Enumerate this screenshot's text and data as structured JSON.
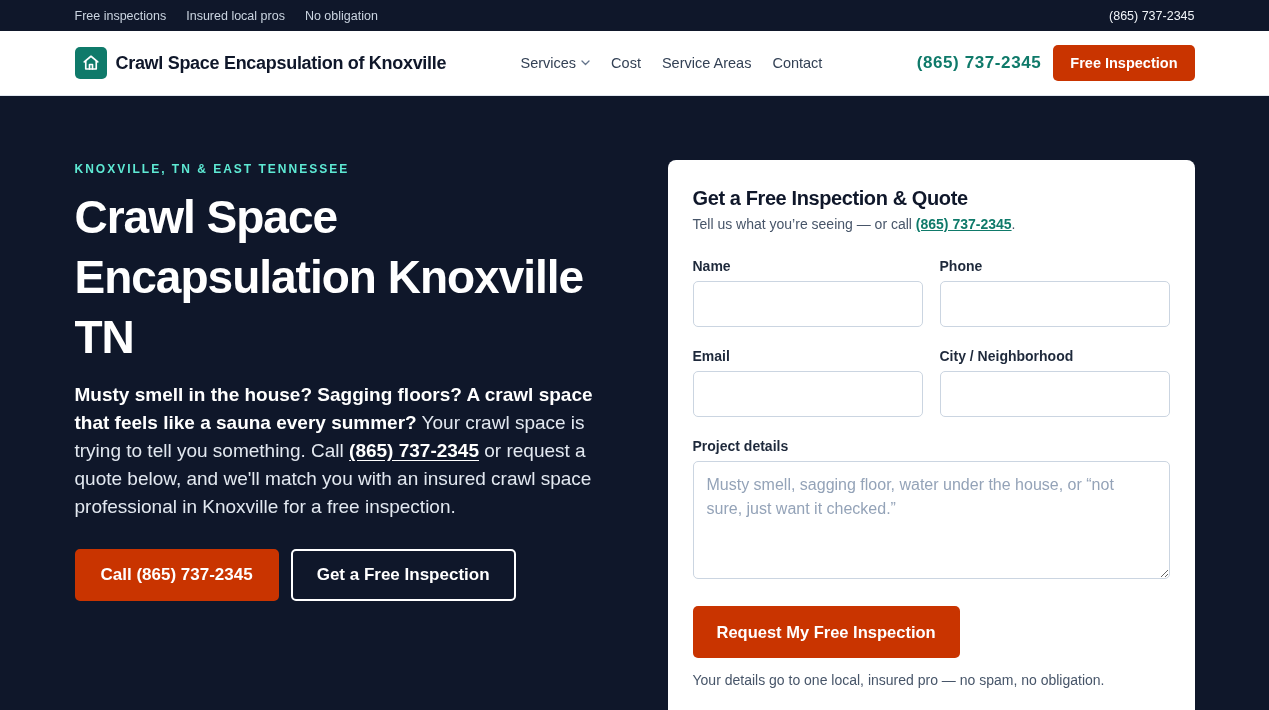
{
  "top_bar": {
    "badges": [
      "Free inspections",
      "Insured local pros",
      "No obligation"
    ],
    "phone": "(865) 737-2345"
  },
  "header": {
    "brand": "Crawl Space Encapsulation of Knoxville",
    "nav": [
      {
        "label": "Services",
        "has_menu": true
      },
      {
        "label": "Cost",
        "has_menu": false
      },
      {
        "label": "Service Areas",
        "has_menu": false
      },
      {
        "label": "Contact",
        "has_menu": false
      }
    ],
    "phone": "(865) 737-2345",
    "cta": "Free Inspection"
  },
  "hero": {
    "eyebrow": "KNOXVILLE, TN & EAST TENNESSEE",
    "title": "Crawl Space Encapsulation Knoxville TN",
    "intro": {
      "before": "**Musty smell in the house? Sagging floors? A crawl space that feels like a sauna every summer?** Your crawl space is trying to tell you something. Call ",
      "link": "(865) 737-2345",
      "after": " or request a quote below, and we'll match you with an insured crawl space professional in Knoxville for a free inspection."
    },
    "buttons": [
      {
        "label": "Call (865) 737-2345",
        "kind": "primary"
      },
      {
        "label": "Get a Free Inspection",
        "kind": "outline"
      }
    ]
  },
  "form": {
    "title": "Get a Free Inspection & Quote",
    "subtitle": {
      "before": "Tell us what you’re seeing — or call ",
      "link": "(865) 737-2345",
      "after": "."
    },
    "fields": [
      {
        "label": "Name",
        "kind": "input"
      },
      {
        "label": "Phone",
        "kind": "input"
      },
      {
        "label": "Email",
        "kind": "input"
      },
      {
        "label": "City / Neighborhood",
        "kind": "input"
      },
      {
        "label": "Project details",
        "kind": "textarea",
        "placeholder": "Musty smell, sagging floor, water under the house, or “not sure, just want it checked.”"
      }
    ],
    "submit": "Request My Free Inspection",
    "note": "Your details go to one local, insured pro — no spam, no obligation."
  }
}
